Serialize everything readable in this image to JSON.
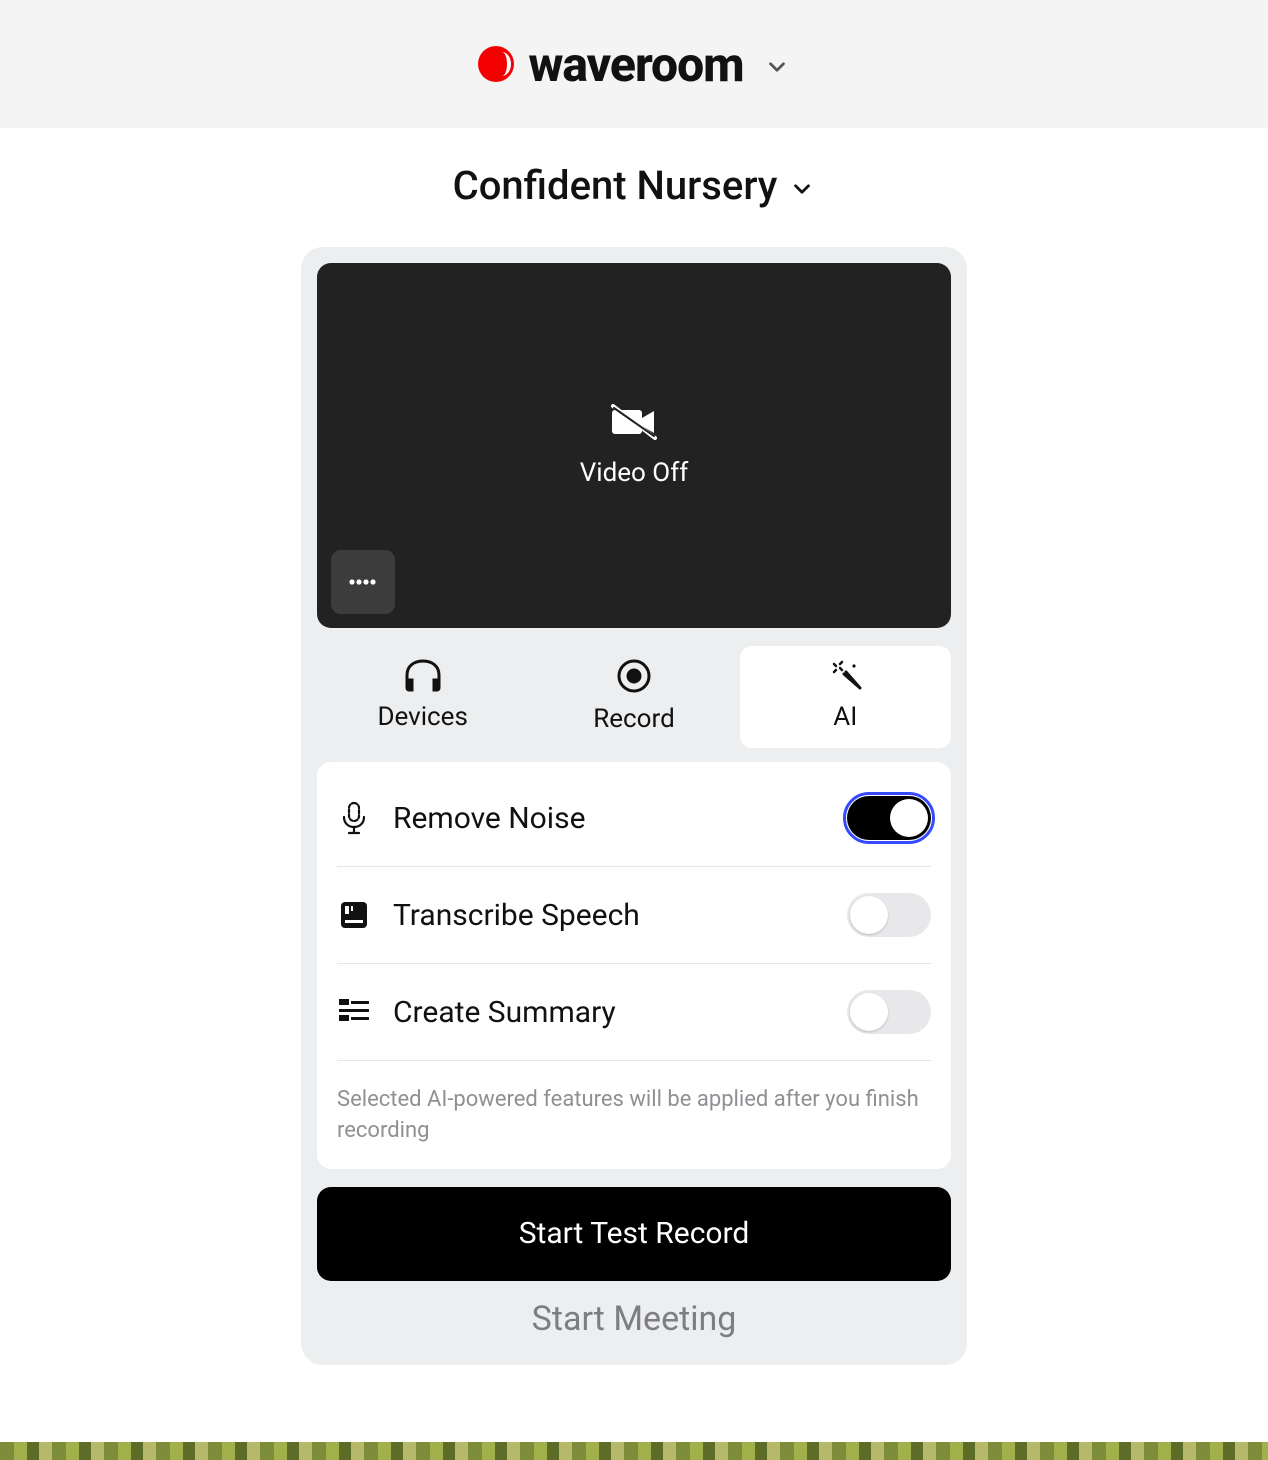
{
  "brand": {
    "name": "waveroom"
  },
  "room": {
    "name": "Confident Nursery"
  },
  "preview": {
    "label": "Video Off"
  },
  "tabs": {
    "devices": "Devices",
    "record": "Record",
    "ai": "AI",
    "active": "ai"
  },
  "ai": {
    "removeNoise": {
      "label": "Remove Noise",
      "on": true
    },
    "transcribe": {
      "label": "Transcribe Speech",
      "on": false
    },
    "summary": {
      "label": "Create Summary",
      "on": false
    },
    "note": "Selected AI-powered features will be applied after you finish recording"
  },
  "buttons": {
    "startTest": "Start Test Record",
    "startMeeting": "Start Meeting"
  }
}
